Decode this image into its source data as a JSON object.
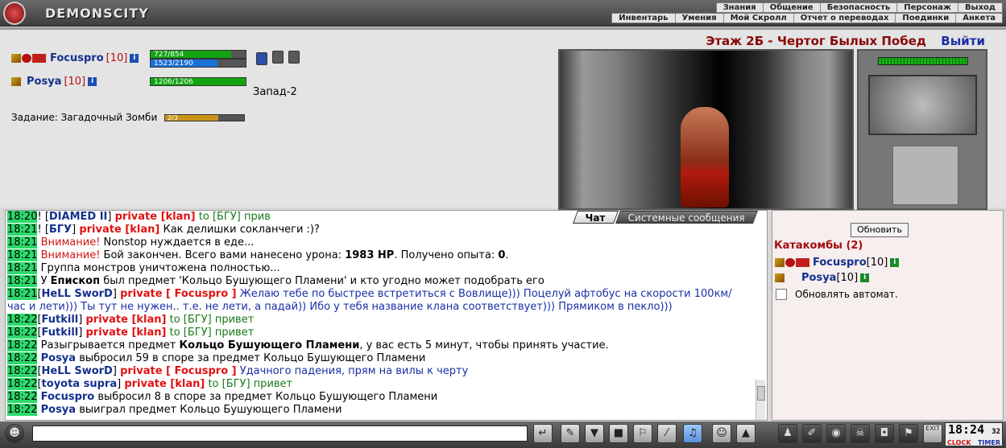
{
  "header": {
    "brand": "DEMONSCITY",
    "menu_top": [
      "Знания",
      "Общение",
      "Безопасность",
      "Персонаж",
      "Выход"
    ],
    "menu_bottom": [
      "Инвентарь",
      "Умения",
      "Мой Скролл",
      "Отчет о переводах",
      "Поединки",
      "Анкета"
    ]
  },
  "main": {
    "location_title": "Этаж 2Б - Чертог Былых Побед",
    "exit_label": "Выйти",
    "players": [
      {
        "name": "Focuspro",
        "level": "[10]",
        "hp_text": "727/854",
        "hp_fraction": 0.85,
        "mp_text": "1523/2190",
        "mp_fraction": 0.7
      },
      {
        "name": "Posya",
        "level": "[10]",
        "hp_text": "1206/1206",
        "hp_fraction": 1.0,
        "position": "Запад-2"
      }
    ],
    "info_glyph": "i",
    "task_label": "Задание: Загадочный Зомби",
    "task_progress_text": "2/3",
    "task_progress_fraction": 0.67
  },
  "chat": {
    "tabs": [
      "Чат",
      "Системные сообщения"
    ],
    "lines": [
      {
        "ts": "18:20",
        "pre": "! ",
        "nick": "DIAMED II",
        "prv": "private [klan]",
        "to": " to [БГУ] ",
        "text": "прив"
      },
      {
        "ts": "18:21",
        "pre": "! ",
        "nick": "БГУ",
        "prv": "private [klan]",
        "text": "Как делишки сокланчеги :)?"
      },
      {
        "ts": "18:21",
        "warn": "Внимание!",
        "text": " Nonstop нуждается в еде..."
      },
      {
        "ts": "18:21",
        "warn": "Внимание!",
        "text": " Бой закончен. Всего вами нанесено урона: ",
        "b1": "1983 HP",
        "t2": ". Получено опыта: ",
        "b2": "0",
        "t3": "."
      },
      {
        "ts": "18:21",
        "text": "Группа монстров уничтожена полностью..."
      },
      {
        "ts": "18:21",
        "text": "У ",
        "b1": "Епископ",
        "t2": " был предмет 'Кольцо Бушующего Пламени' и кто угодно может подобрать его"
      },
      {
        "ts": "18:21",
        "nick": "HeLL SworD",
        "prv": "private [ Focuspro ]",
        "text": "Желаю тебе по быстрее встретиться с Вовлище))) Поцелуй афтобус на скорости 100км/час и лети))) Ты тут не нужен.. т.е. не лети, а падай)) Ибо у тебя название клана соответствует))) Прямиком в пекло)))"
      },
      {
        "ts": "18:22",
        "nick": "Futkill",
        "prv": "private [klan]",
        "to": " to [БГУ] ",
        "text": "привет"
      },
      {
        "ts": "18:22",
        "nick": "Futkill",
        "prv": "private [klan]",
        "to": " to [БГУ] ",
        "text": "привет"
      },
      {
        "ts": "18:22",
        "text": "Разыгрывается предмет ",
        "b1": "Кольцо Бушующего Пламени",
        "t2": ", у вас есть 5 минут, чтобы принять участие."
      },
      {
        "ts": "18:22",
        "b0": "Posya",
        "text": " выбросил 59 в споре за предмет Кольцо Бушующего Пламени"
      },
      {
        "ts": "18:22",
        "nick": "HeLL SworD",
        "prv": "private [ Focuspro ]",
        "text": "Удачного падения, прям на вилы к черту"
      },
      {
        "ts": "18:22",
        "nick": "toyota supra",
        "prv": "private [klan]",
        "to": " to [БГУ] ",
        "text": "привет"
      },
      {
        "ts": "18:22",
        "b0": "Focuspro",
        "text": " выбросил 8 в споре за предмет Кольцо Бушующего Пламени"
      },
      {
        "ts": "18:22",
        "b0": "Posya",
        "text": " выиграл предмет Кольцо Бушующего Пламени"
      }
    ]
  },
  "sidebar": {
    "refresh_label": "Обновить",
    "group_title": "Катакомбы (2)",
    "members": [
      {
        "name": "Focuspro",
        "level": "[10]"
      },
      {
        "name": "Posya",
        "level": "[10]"
      }
    ],
    "auto_label": "Обновлять автомат."
  },
  "footer": {
    "time": "18:24",
    "seconds": "32",
    "clock_label": "CLOCK",
    "timer_label": "TIMER",
    "exit_label": "EXIT"
  },
  "colors": {
    "accent_red": "#d11414",
    "accent_blue": "#1a2fa6",
    "timestamp_green": "#2dd96b"
  }
}
